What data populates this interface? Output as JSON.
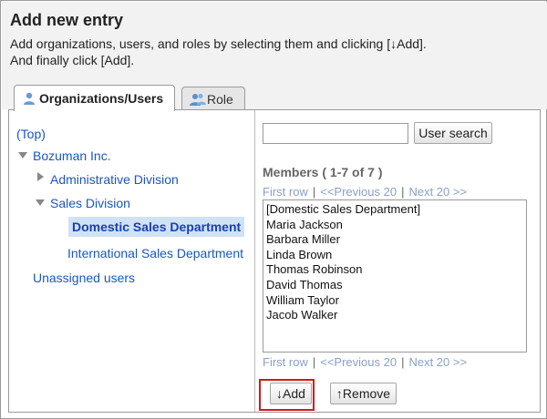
{
  "header": {
    "title": "Add new entry",
    "line1": "Add organizations, users, and roles by selecting them and clicking [↓Add].",
    "line2": "And finally click [Add]."
  },
  "tabs": [
    {
      "label": "Organizations/Users",
      "icon": "user-icon",
      "active": true
    },
    {
      "label": "Role",
      "icon": "role-users-icon",
      "active": false
    }
  ],
  "tree": {
    "top": "(Top)",
    "root": "Bozuman Inc.",
    "admin_div": "Administrative Division",
    "sales_div": "Sales Division",
    "domestic": "Domestic Sales Department",
    "international": "International Sales Department",
    "unassigned": "Unassigned users"
  },
  "search": {
    "value": "",
    "button": "User search"
  },
  "members": {
    "title": "Members ( 1-7 of 7 )",
    "pager": {
      "first": "First row",
      "prev": "<<Previous 20",
      "next": "Next 20 >>",
      "sep": "|"
    },
    "items": [
      "[Domestic Sales Department]",
      "Maria Jackson",
      "Barbara Miller",
      "Linda Brown",
      "Thomas Robinson",
      "David Thomas",
      "William Taylor",
      "Jacob Walker"
    ]
  },
  "actions": {
    "add": "↓Add",
    "remove": "↑Remove"
  },
  "colors": {
    "link": "#1a56c4",
    "selected_bg": "#cfe2f6",
    "highlight": "#d11a1a"
  }
}
